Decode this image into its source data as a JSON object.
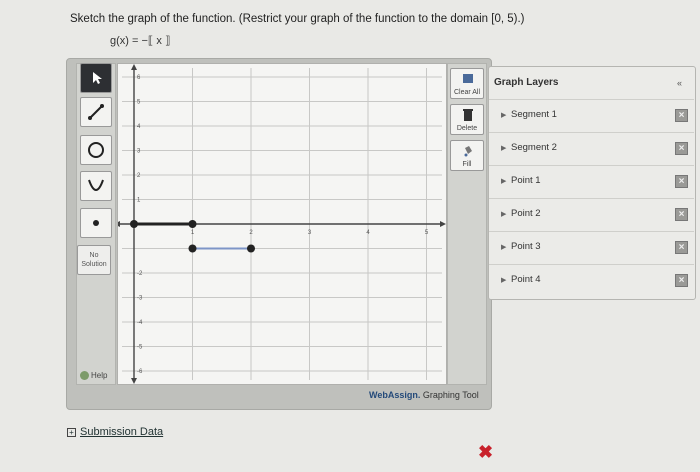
{
  "question": {
    "prompt": "Sketch the graph of the function. (Restrict your graph of the function to the domain [0, 5).)",
    "formula": "g(x) = −⟦ x ⟧"
  },
  "tools": {
    "left": [
      {
        "name": "pointer-tool",
        "icon": "arrow-icon"
      },
      {
        "name": "line-segment-tool",
        "icon": "segment-icon"
      },
      {
        "name": "circle-tool",
        "icon": "circle-icon"
      },
      {
        "name": "parabola-tool",
        "icon": "parabola-icon"
      },
      {
        "name": "point-tool",
        "icon": "dot-icon"
      }
    ],
    "no_solution": "No Solution",
    "help": "Help",
    "right": [
      {
        "label": "Clear All",
        "icon": "clear-icon"
      },
      {
        "label": "Delete",
        "icon": "trash-icon"
      },
      {
        "label": "Fill",
        "icon": "fill-icon"
      }
    ]
  },
  "graph": {
    "x_ticks": [
      "1",
      "2",
      "3",
      "4",
      "5"
    ],
    "y_ticks_pos": [
      "6",
      "5",
      "4",
      "3",
      "2",
      "1"
    ],
    "y_ticks_neg": [
      "-2",
      "-3",
      "-4",
      "-5",
      "-6"
    ],
    "segments": [
      {
        "x1": 0,
        "x2": 1,
        "y": 0
      },
      {
        "x1": 1,
        "x2": 2,
        "y": -1
      }
    ],
    "points": [
      {
        "x": 0,
        "y": 0
      },
      {
        "x": 1,
        "y": 0
      },
      {
        "x": 1,
        "y": -1
      },
      {
        "x": 2,
        "y": -1
      }
    ]
  },
  "brand": {
    "name": "WebAssign.",
    "suffix": " Graphing Tool"
  },
  "layers": {
    "title": "Graph Layers",
    "collapse_icon": "«",
    "items": [
      "Segment 1",
      "Segment 2",
      "Point 1",
      "Point 2",
      "Point 3",
      "Point 4"
    ]
  },
  "submission": {
    "label": "Submission Data"
  },
  "status": {
    "result_icon": "red-x-icon",
    "result_color": "#c8212b"
  }
}
